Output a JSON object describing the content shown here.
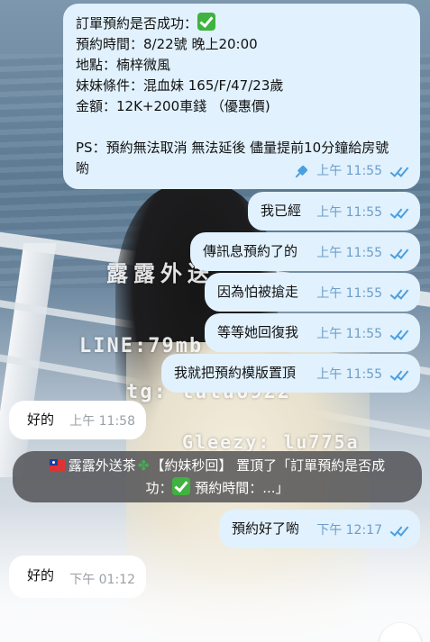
{
  "background": {
    "watermark_1": "露露外送",
    "watermark_2": "LINE:79mb",
    "watermark_3": "tg: lulu6922",
    "watermark_4": "Gleezy: lu775a"
  },
  "messages": [
    {
      "direction": "outgoing",
      "lines": [
        "訂單預約是否成功：",
        "預約時間：8/22號 晚上20:00",
        "地點：楠梓微風",
        "妹妹條件：混血妹 165/F/47/23歲",
        "金額：12K+200車錢 （優惠價)",
        "",
        "PS：預約無法取消 無法延後  儘量提前10分鐘給房號",
        "喲"
      ],
      "time": "上午 11:55",
      "pinned": true,
      "status": "read"
    },
    {
      "direction": "outgoing",
      "text": "我已經",
      "time": "上午 11:55",
      "status": "read"
    },
    {
      "direction": "outgoing",
      "text": "傳訊息預約了的",
      "time": "上午 11:55",
      "status": "read"
    },
    {
      "direction": "outgoing",
      "text": "因為怕被搶走",
      "time": "上午 11:55",
      "status": "read"
    },
    {
      "direction": "outgoing",
      "text": "等等她回復我",
      "time": "上午 11:55",
      "status": "read"
    },
    {
      "direction": "outgoing",
      "text": "我就把預約模版置頂",
      "time": "上午 11:55",
      "status": "read"
    },
    {
      "direction": "incoming",
      "text": "好的",
      "time": "上午 11:58"
    },
    {
      "direction": "outgoing",
      "text": "預約好了喲",
      "time": "下午 12:17",
      "status": "read"
    },
    {
      "direction": "incoming",
      "text": "好的",
      "time": "下午 01:12"
    }
  ],
  "pinned_banner": {
    "sender": "露露外送茶",
    "tag": "【約妹秒回】",
    "action": " 置頂了「訂單預約是否成",
    "line2_start": "功：",
    "line2_end": " 預約時間：...」"
  },
  "icons": {
    "read_status": "double-check-icon",
    "pin": "pin-icon",
    "success": "check-mark-button-icon",
    "flag": "taiwan-flag-icon",
    "clover": "four-leaf-clover-icon"
  },
  "colors": {
    "outgoing_bubble": "#e1f1fd",
    "incoming_bubble": "#ffffff",
    "outgoing_time": "#6b9ecb",
    "incoming_time": "#9aa0a6",
    "check": "#4a9fe0"
  }
}
